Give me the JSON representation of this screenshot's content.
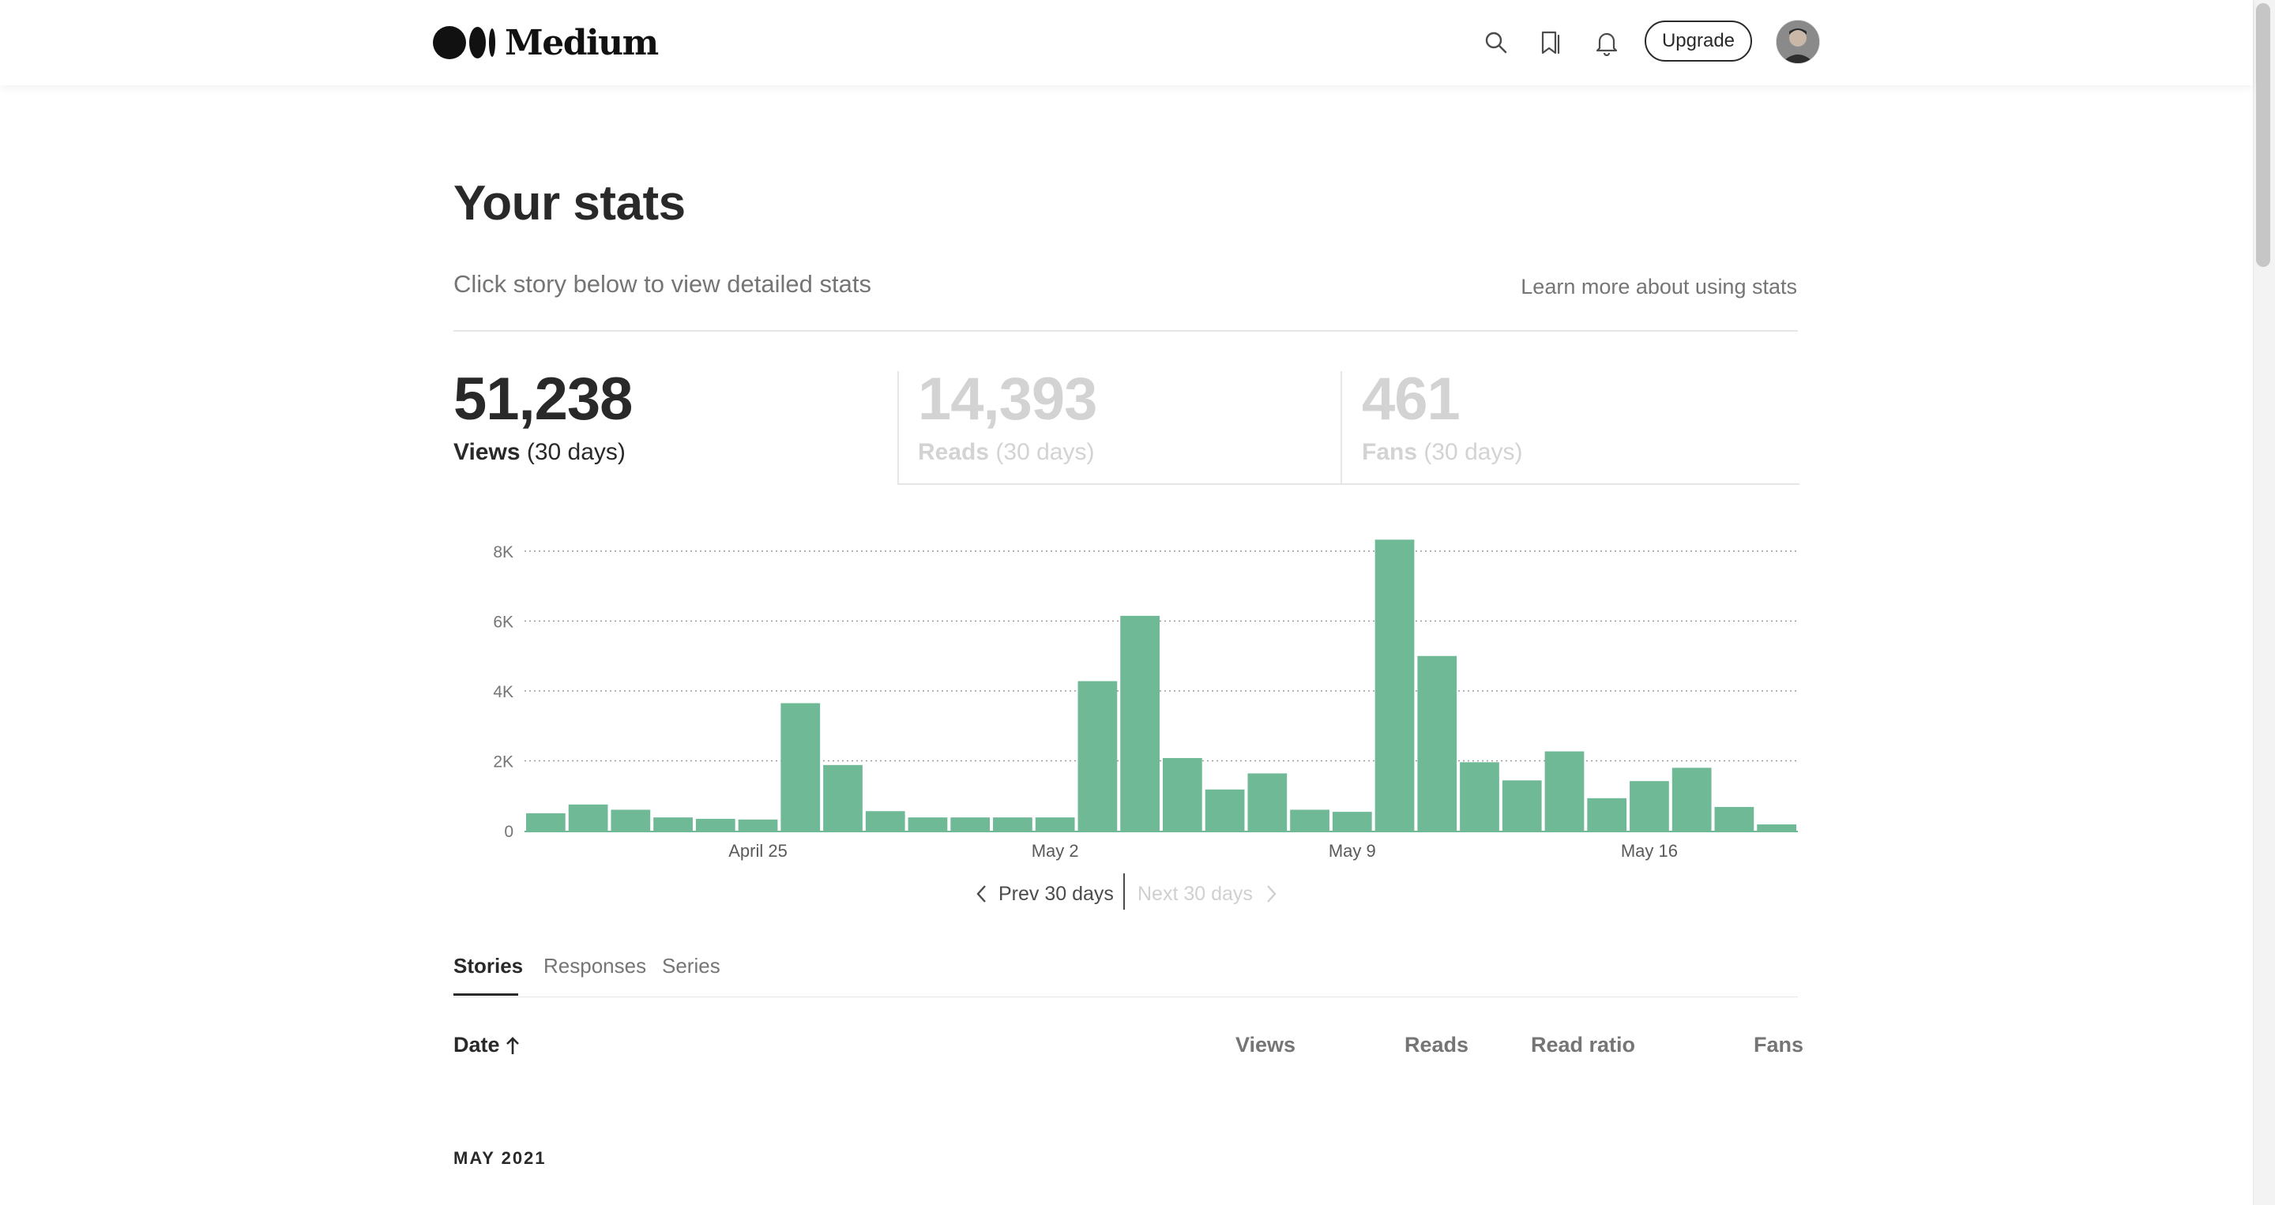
{
  "header": {
    "logo_text": "Medium",
    "icons": [
      "search-icon",
      "bookmarks-icon",
      "notifications-icon"
    ],
    "upgrade_label": "Upgrade"
  },
  "page": {
    "title": "Your stats",
    "subtitle": "Click story below to view detailed stats",
    "learn_more": "Learn more about using stats"
  },
  "stats": [
    {
      "value": "51,238",
      "label": "Views",
      "period": "(30 days)",
      "active": true
    },
    {
      "value": "14,393",
      "label": "Reads",
      "period": "(30 days)",
      "active": false
    },
    {
      "value": "461",
      "label": "Fans",
      "period": "(30 days)",
      "active": false
    }
  ],
  "nav": {
    "prev_label": "Prev 30 days",
    "next_label": "Next 30 days"
  },
  "tabs": [
    "Stories",
    "Responses",
    "Series"
  ],
  "table": {
    "columns": [
      "Date",
      "Views",
      "Reads",
      "Read ratio",
      "Fans"
    ],
    "month_heading": "MAY 2021"
  },
  "chart_data": {
    "type": "bar",
    "series": [
      {
        "values": [
          500,
          750,
          600,
          380,
          340,
          320,
          3650,
          1880,
          560,
          380,
          380,
          380,
          380,
          4280,
          6150,
          2080,
          1180,
          1640,
          600,
          540,
          8330,
          5000,
          1960,
          1440,
          2270,
          930,
          1420,
          1800,
          680,
          180
        ]
      }
    ],
    "x_tick_labels": [
      {
        "label": "April 25",
        "index": 5
      },
      {
        "label": "May 2",
        "index": 12
      },
      {
        "label": "May 9",
        "index": 19
      },
      {
        "label": "May 16",
        "index": 26
      }
    ],
    "y_ticks": [
      "0",
      "2K",
      "4K",
      "6K",
      "8K"
    ],
    "y_tick_values": [
      0,
      2000,
      4000,
      6000,
      8000
    ],
    "ylim": [
      0,
      8000
    ],
    "grid": true,
    "bar_color": "#6fb997"
  },
  "colors": {
    "accent": "#6fb997",
    "text_dark": "#292929",
    "text_muted": "#757575"
  }
}
